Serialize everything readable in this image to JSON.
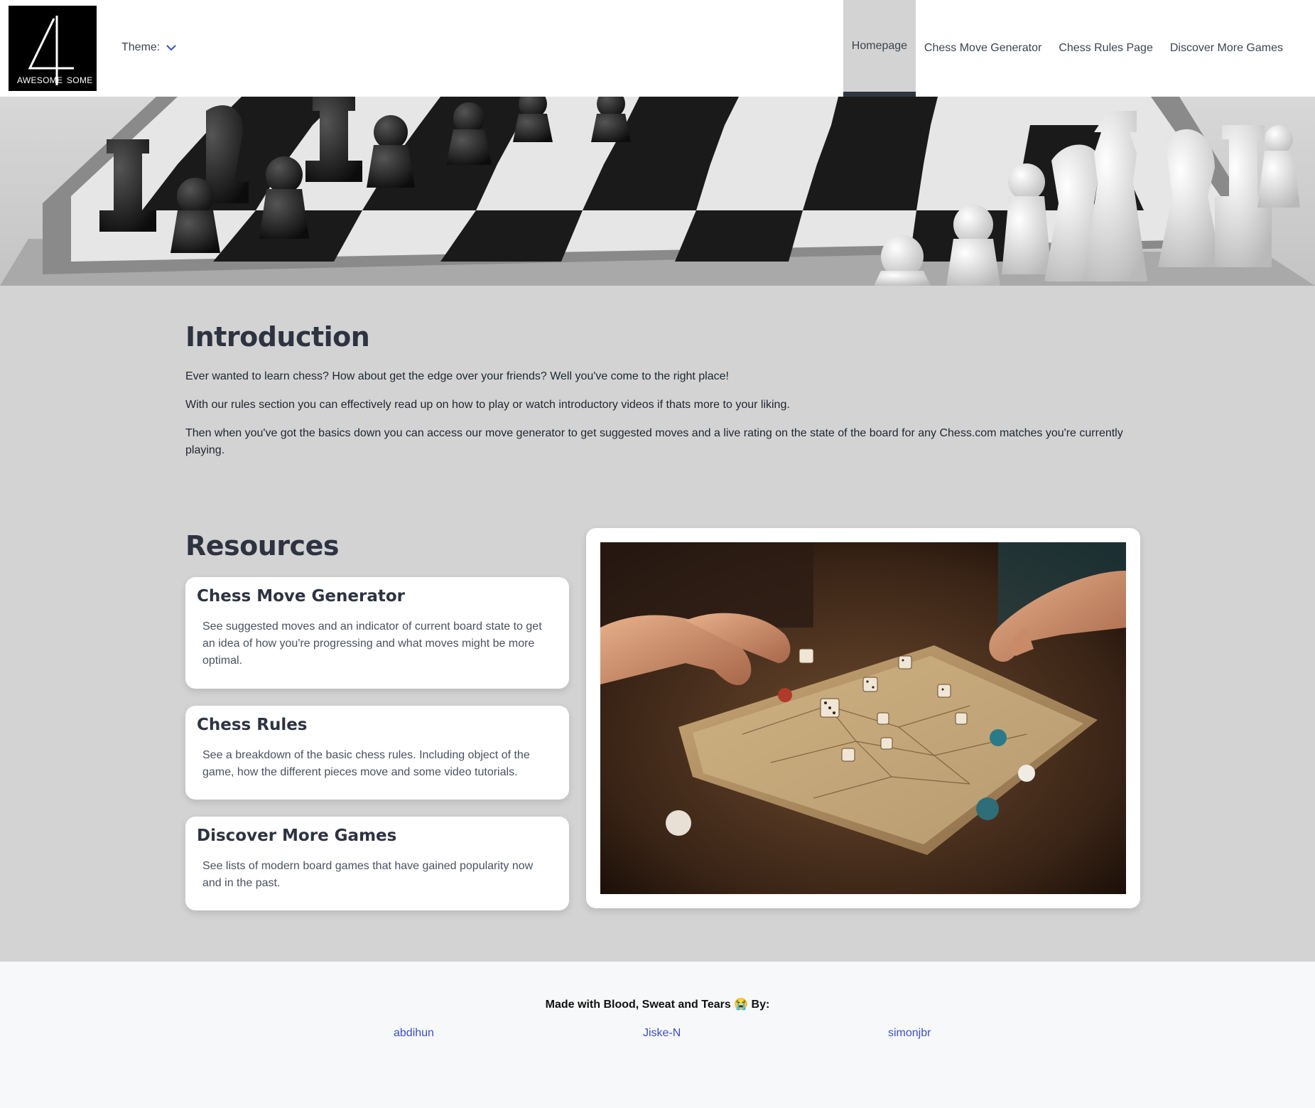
{
  "logo": {
    "big_char": "4",
    "left_text": "AWESOME",
    "right_text": "SOME"
  },
  "theme": {
    "label": "Theme:"
  },
  "nav": {
    "items": [
      {
        "label": "Homepage",
        "active": true
      },
      {
        "label": "Chess Move Generator",
        "active": false
      },
      {
        "label": "Chess Rules Page",
        "active": false
      },
      {
        "label": "Discover More Games",
        "active": false
      }
    ]
  },
  "intro": {
    "title": "Introduction",
    "paragraphs": [
      "Ever wanted to learn chess? How about get the edge over your friends? Well you've come to the right place!",
      "With our rules section you can effectively read up on how to play or watch introductory videos if thats more to your liking.",
      "Then when you've got the basics down you can access our move generator to get suggested moves and a live rating on the state of the board for any Chess.com matches you're currently playing."
    ]
  },
  "resources": {
    "title": "Resources",
    "cards": [
      {
        "title": "Chess Move Generator",
        "desc": "See suggested moves and an indicator of current board state to get an idea of how you're progressing and what moves might be more optimal."
      },
      {
        "title": "Chess Rules",
        "desc": "See a breakdown of the basic chess rules. Including object of the game, how the different pieces move and some video tutorials."
      },
      {
        "title": "Discover More Games",
        "desc": "See lists of modern board games that have gained popularity now and in the past."
      }
    ]
  },
  "footer": {
    "title": "Made with Blood, Sweat and Tears 😭 By:",
    "authors": [
      "abdihun",
      "Jiske-N",
      "simonjbr"
    ]
  },
  "colors": {
    "nav_active_bg": "#d3d3d3",
    "nav_active_border": "#2f3641",
    "page_bg": "#d3d3d3",
    "footer_bg": "#f7f8fa",
    "link": "#3a4fc8",
    "heading": "#2d3340"
  },
  "icons": {
    "theme_dropdown": "chevron-down-icon"
  }
}
